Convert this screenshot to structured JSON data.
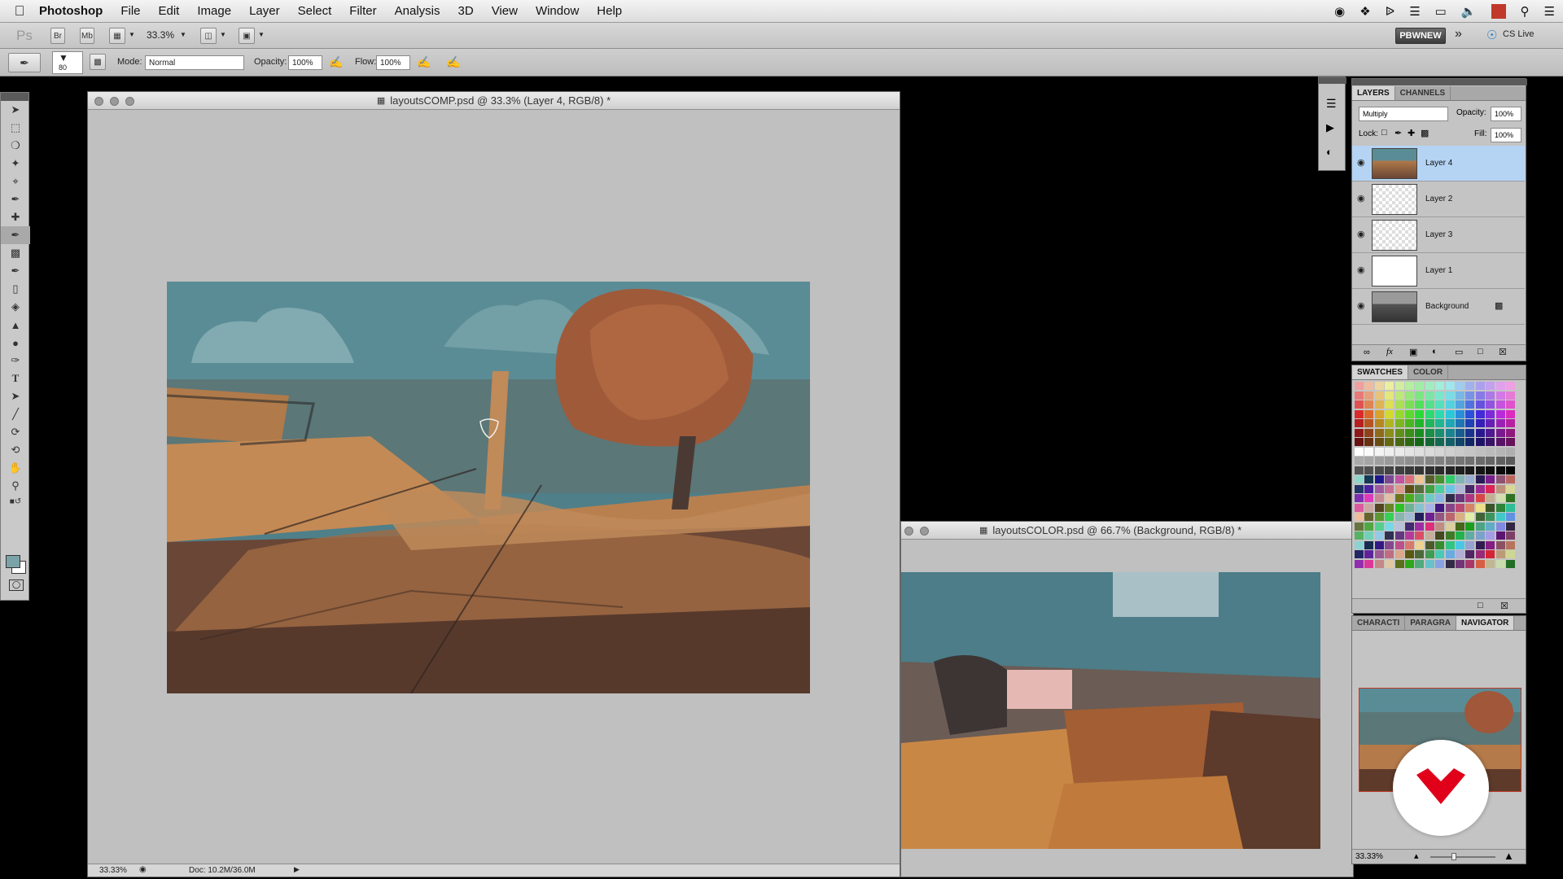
{
  "menubar": {
    "app": "Photoshop",
    "items": [
      "File",
      "Edit",
      "Image",
      "Layer",
      "Select",
      "Filter",
      "Analysis",
      "3D",
      "View",
      "Window",
      "Help"
    ]
  },
  "appbar": {
    "ps_logo": "Ps",
    "br": "Br",
    "mb": "Mb",
    "zoom": "33.3%",
    "workspace": "PBWNEW",
    "cs_live": "CS Live"
  },
  "options": {
    "brush_size": "80",
    "mode_label": "Mode:",
    "mode_value": "Normal",
    "opacity_label": "Opacity:",
    "opacity_value": "100%",
    "flow_label": "Flow:",
    "flow_value": "100%"
  },
  "doc_main": {
    "title": "layoutsCOMP.psd @ 33.3% (Layer 4, RGB/8) *",
    "status_zoom": "33.33%",
    "status_doc": "Doc: 10.2M/36.0M"
  },
  "doc_second": {
    "title": "layoutsCOLOR.psd @ 66.7% (Background, RGB/8) *"
  },
  "layers_panel": {
    "tabs": [
      "LAYERS",
      "CHANNELS"
    ],
    "blend_mode": "Multiply",
    "opacity_label": "Opacity:",
    "opacity_value": "100%",
    "lock_label": "Lock:",
    "fill_label": "Fill:",
    "fill_value": "100%",
    "layers": [
      {
        "name": "Layer 4",
        "selected": true
      },
      {
        "name": "Layer 2",
        "selected": false
      },
      {
        "name": "Layer 3",
        "selected": false
      },
      {
        "name": "Layer 1",
        "selected": false
      },
      {
        "name": "Background",
        "selected": false
      }
    ]
  },
  "swatches_panel": {
    "tabs": [
      "SWATCHES",
      "COLOR"
    ]
  },
  "navigator_panel": {
    "tabs": [
      "CHARACTI",
      "PARAGRA",
      "NAVIGATOR"
    ],
    "zoom": "33.33%"
  },
  "colors": {
    "sky": "#5a8a94",
    "tree": "#a0573a",
    "ground": "#c88446",
    "dark_ground": "#5e3a2a",
    "selection": "#b5d4f4",
    "logo_red": "#e1001a"
  }
}
